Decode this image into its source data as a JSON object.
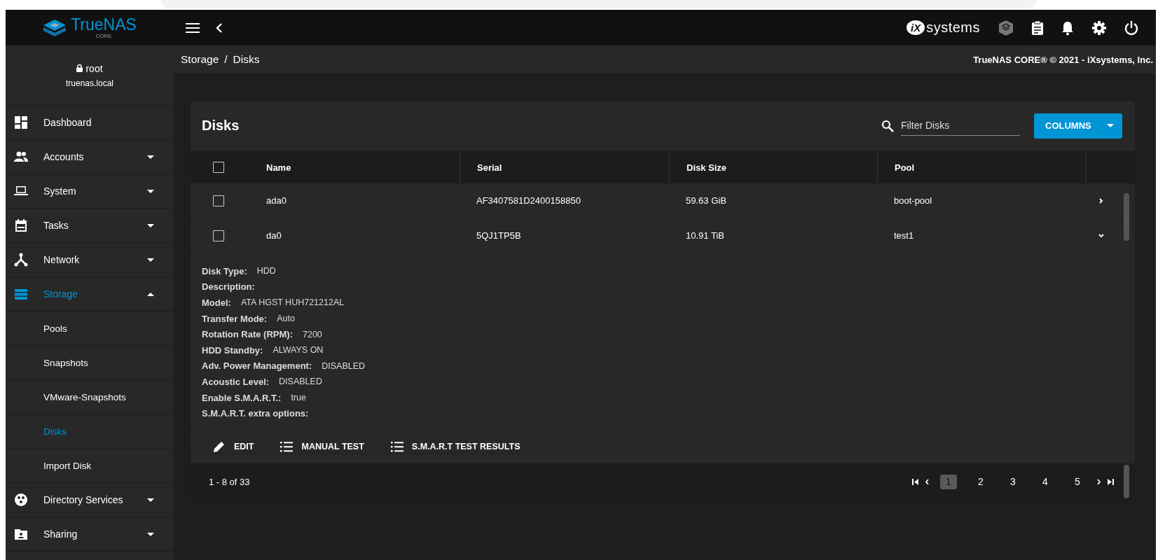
{
  "topbar": {
    "logo_name": "TrueNAS",
    "logo_edition": "CORE",
    "vendor_mark": "iX",
    "vendor_name": "systems"
  },
  "breadcrumb": {
    "items": [
      "Storage",
      "Disks"
    ],
    "separator": "/",
    "copyright": "TrueNAS CORE® © 2021 - iXsystems, Inc."
  },
  "sidebar": {
    "user": "root",
    "host": "truenas.local",
    "items": [
      {
        "label": "Dashboard",
        "kind": "link",
        "selected": false
      },
      {
        "label": "Accounts",
        "kind": "group",
        "selected": false,
        "expanded": false
      },
      {
        "label": "System",
        "kind": "group",
        "selected": false,
        "expanded": false
      },
      {
        "label": "Tasks",
        "kind": "group",
        "selected": false,
        "expanded": false
      },
      {
        "label": "Network",
        "kind": "group",
        "selected": false,
        "expanded": false
      },
      {
        "label": "Storage",
        "kind": "group",
        "selected": true,
        "expanded": true,
        "children": [
          {
            "label": "Pools",
            "selected": false
          },
          {
            "label": "Snapshots",
            "selected": false
          },
          {
            "label": "VMware-Snapshots",
            "selected": false
          },
          {
            "label": "Disks",
            "selected": true
          },
          {
            "label": "Import Disk",
            "selected": false
          }
        ]
      },
      {
        "label": "Directory Services",
        "kind": "group",
        "selected": false,
        "expanded": false
      },
      {
        "label": "Sharing",
        "kind": "group",
        "selected": false,
        "expanded": false
      }
    ]
  },
  "card": {
    "title": "Disks",
    "filter": {
      "placeholder": "Filter Disks"
    },
    "columns_button": "COLUMNS",
    "table": {
      "select_all_checked": false,
      "columns": [
        "Name",
        "Serial",
        "Disk Size",
        "Pool"
      ],
      "rows": [
        {
          "name": "ada0",
          "serial": "AF3407581D2400158850",
          "disk_size": "59.63 GiB",
          "pool": "boot-pool",
          "checked": false,
          "expanded": false
        },
        {
          "name": "da0",
          "serial": "5QJ1TP5B",
          "disk_size": "10.91 TiB",
          "pool": "test1",
          "checked": false,
          "expanded": true
        }
      ]
    },
    "details": [
      {
        "label": "Disk Type:",
        "value": "HDD"
      },
      {
        "label": "Description:"
      },
      {
        "label": "Model:",
        "value": "ATA HGST HUH721212AL"
      },
      {
        "label": "Transfer Mode:",
        "value": "Auto"
      },
      {
        "label": "Rotation Rate (RPM):",
        "value": "7200"
      },
      {
        "label": "HDD Standby:",
        "value": "ALWAYS ON"
      },
      {
        "label": "Adv. Power Management:",
        "value": "DISABLED"
      },
      {
        "label": "Acoustic Level:",
        "value": "DISABLED"
      },
      {
        "label": "Enable S.M.A.R.T.:",
        "value": "true"
      },
      {
        "label": "S.M.A.R.T. extra options:"
      }
    ],
    "actions": [
      {
        "label": "EDIT",
        "kind": "edit"
      },
      {
        "label": "MANUAL TEST",
        "kind": "list"
      },
      {
        "label": "S.M.A.R.T TEST RESULTS",
        "kind": "list"
      }
    ],
    "footer": {
      "range": "1 - 8 of 33",
      "pages": [
        {
          "label": "1",
          "selected": true
        },
        {
          "label": "2",
          "selected": false
        },
        {
          "label": "3",
          "selected": false
        },
        {
          "label": "4",
          "selected": false
        },
        {
          "label": "5",
          "selected": false
        }
      ]
    }
  }
}
